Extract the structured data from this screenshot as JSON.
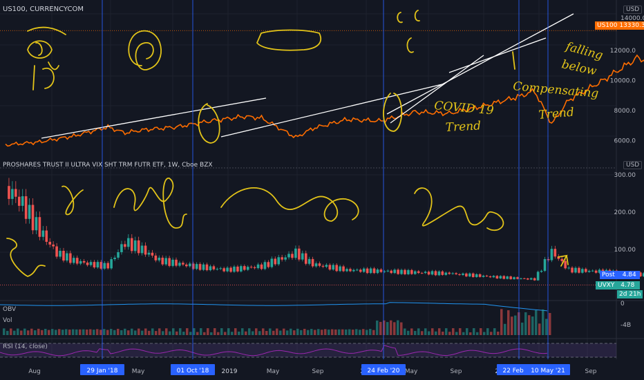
{
  "window": {
    "currency": "USD"
  },
  "top_panel": {
    "title": "US100, CURRENCYCOM",
    "price_badge_symbol": "US100",
    "price_badge_value": "13330.3",
    "top_partial_label": "14000.0"
  },
  "bottom_panel": {
    "title": "PROSHARES TRUST II ULTRA VIX SHT TRM FUTR ETF, 1W, Cboe BZX",
    "post_label": "Post",
    "post_value": "4.84",
    "ticker_label": "UVXY",
    "ticker_value": "4.78",
    "countdown": "2d 21h"
  },
  "obv_panel": {
    "label": "OBV",
    "axis_zero": "0",
    "axis_low": "-4B"
  },
  "vol_panel": {
    "label": "Vol"
  },
  "rsi_panel": {
    "label": "RSI (14, close)"
  },
  "annotations": {
    "covid_trend": [
      "COVID 19",
      "Trend"
    ],
    "falling_below": [
      "falling",
      "below"
    ],
    "compensating_trend": [
      "Compensating",
      "Trend"
    ]
  },
  "colors": {
    "background": "#131722",
    "price_line": "#ff6d00",
    "up": "#26a69a",
    "down": "#ef5350",
    "highlight": "#2962ff",
    "drawing": "#e3c419",
    "obv": "#2196f3",
    "rsi": "#9c27b0"
  },
  "chart_data": [
    {
      "type": "line",
      "symbol": "US100",
      "title": "US100, CURRENCYCOM",
      "x": [
        "2017-07",
        "2017-09",
        "2017-11",
        "2018-01",
        "2018-02",
        "2018-03",
        "2018-05",
        "2018-07",
        "2018-09",
        "2018-10",
        "2018-12",
        "2019-01",
        "2019-03",
        "2019-05",
        "2019-07",
        "2019-09",
        "2019-11",
        "2020-01",
        "2020-02",
        "2020-03",
        "2020-04",
        "2020-06",
        "2020-08",
        "2020-09",
        "2020-10",
        "2020-12",
        "2021-01",
        "2021-02",
        "2021-03",
        "2021-04",
        "2021-05"
      ],
      "y": [
        5700,
        5900,
        6300,
        6900,
        6500,
        6700,
        6900,
        7300,
        7600,
        7500,
        6200,
        6800,
        7400,
        7300,
        7900,
        7800,
        8300,
        8900,
        9300,
        7100,
        8700,
        10000,
        11500,
        11200,
        11300,
        12800,
        13000,
        13700,
        12600,
        14000,
        13330
      ],
      "y_ticks": [
        6000,
        8000,
        10000,
        12000,
        14000
      ],
      "ylim": [
        5000,
        14300
      ],
      "last_value": 13330.3,
      "scale": "linear"
    },
    {
      "type": "candlestick",
      "symbol": "UVXY",
      "title": "PROSHARES TRUST II ULTRA VIX SHT TRM FUTR ETF, 1W, Cboe BZX",
      "x": [
        "2017-07",
        "2017-08",
        "2017-09",
        "2017-10",
        "2017-11",
        "2017-12",
        "2018-01",
        "2018-02",
        "2018-03",
        "2018-04",
        "2018-06",
        "2018-08",
        "2018-10",
        "2018-12",
        "2019-01",
        "2019-03",
        "2019-06",
        "2019-09",
        "2019-12",
        "2020-02",
        "2020-03",
        "2020-04",
        "2020-06",
        "2020-09",
        "2020-12",
        "2021-02",
        "2021-05"
      ],
      "close": [
        270,
        220,
        150,
        90,
        70,
        60,
        55,
        120,
        100,
        70,
        55,
        45,
        55,
        90,
        60,
        45,
        40,
        35,
        25,
        20,
        95,
        45,
        40,
        30,
        20,
        18,
        4.78
      ],
      "y_ticks": [
        100,
        200,
        300
      ],
      "ylim": [
        0,
        310
      ],
      "last_value": 4.78,
      "post_value": 4.84
    },
    {
      "type": "line",
      "name": "OBV",
      "y_ticks_labels": [
        "0",
        "-4B"
      ]
    },
    {
      "type": "bar",
      "name": "Vol"
    },
    {
      "type": "line",
      "name": "RSI (14, close)"
    }
  ],
  "x_axis": {
    "labels": [
      "Aug",
      "May",
      "2019",
      "May",
      "Sep",
      "202",
      "May",
      "Sep",
      "202",
      "Sep"
    ],
    "highlighted": [
      "29 Jan '18",
      "01 Oct '18",
      "24 Feb '20",
      "22 Feb '21",
      "10 May '21"
    ]
  }
}
